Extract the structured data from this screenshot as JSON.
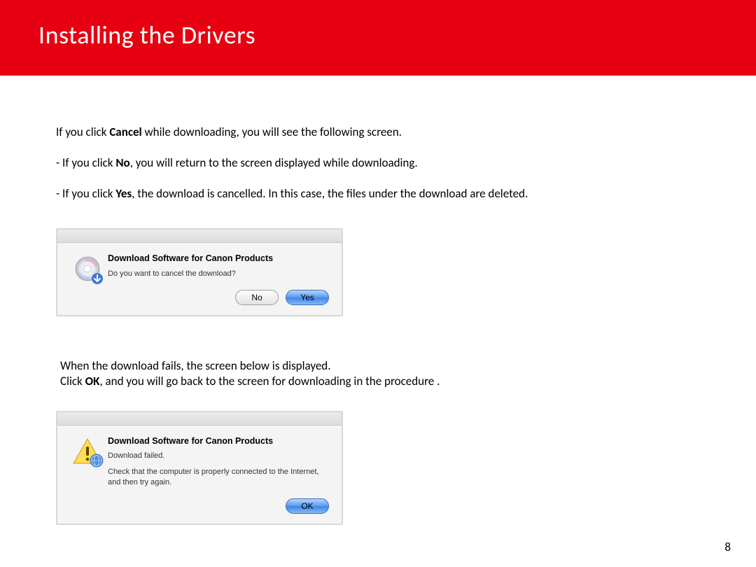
{
  "header": {
    "title": "Installing  the Drivers"
  },
  "body": {
    "intro_pre": "If you click ",
    "intro_bold": "Cancel",
    "intro_post": " while downloading, you will see the following screen.",
    "bullet1_pre": "- If you click ",
    "bullet1_bold": "No",
    "bullet1_post": ", you will return to the screen displayed while downloading.",
    "bullet2_pre": "- If you click ",
    "bullet2_bold": "Yes",
    "bullet2_post": ", the download is cancelled. In this case, the files under the download are deleted.",
    "section2_line1": "When the download fails, the screen below is displayed.",
    "section2_line2_pre": "Click ",
    "section2_line2_bold": "OK",
    "section2_line2_post": ", and you will go back to the screen for downloading in the procedure ."
  },
  "dialog1": {
    "title": "Download Software for Canon Products",
    "message": "Do you want to cancel the download?",
    "no_label": "No",
    "yes_label": "Yes"
  },
  "dialog2": {
    "title": "Download Software for Canon Products",
    "msg1": "Download failed.",
    "msg2": "Check that the computer is properly connected to the Internet, and then try again.",
    "ok_label": "OK"
  },
  "page_number": "8"
}
